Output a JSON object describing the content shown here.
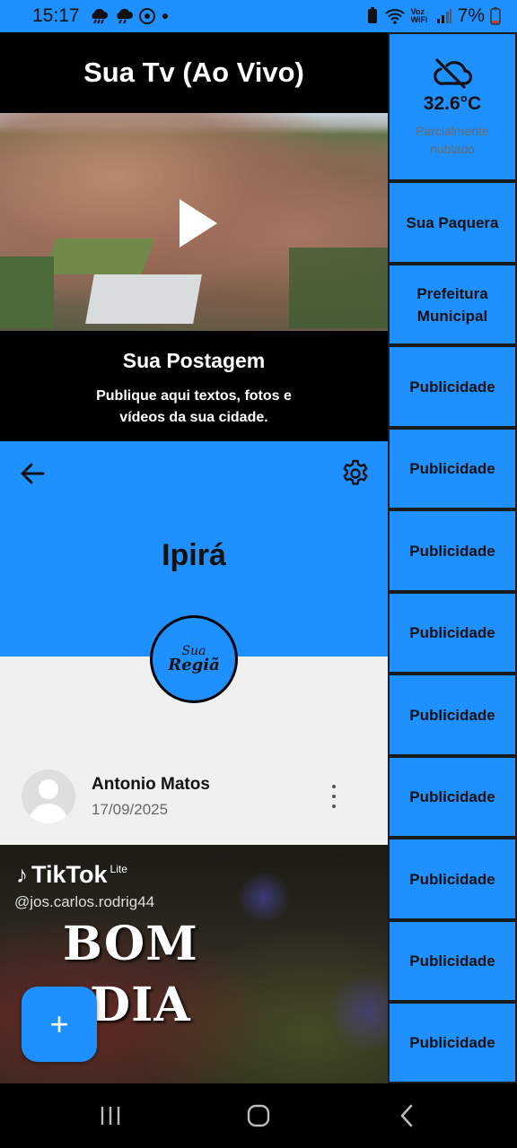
{
  "status_bar": {
    "time": "15:17",
    "network_label": "Voz WiFi",
    "battery": "7%"
  },
  "tv": {
    "title": "Sua Tv (Ao Vivo)"
  },
  "post_box": {
    "title": "Sua Postagem",
    "description": "Publique aqui textos, fotos e vídeos da sua cidade."
  },
  "city": {
    "name": "Ipirá",
    "logo_line1": "Sua",
    "logo_line2": "Regiã"
  },
  "post": {
    "author": "Antonio Matos",
    "date": "17/09/2025",
    "media": {
      "brand": "TikTok",
      "brand_suffix": "Lite",
      "username": "@jos.carlos.rodrig44",
      "line1": "BOM",
      "line2": "DIA"
    }
  },
  "fab": {
    "label": "+"
  },
  "sidebar": {
    "weather": {
      "temperature": "32.6°C",
      "condition": "Parcialmente nublado",
      "icon": "cloud-off-icon"
    },
    "items": [
      {
        "label": "Sua Paquera"
      },
      {
        "label": "Prefeitura Municipal"
      },
      {
        "label": "Publicidade"
      },
      {
        "label": "Publicidade"
      },
      {
        "label": "Publicidade"
      },
      {
        "label": "Publicidade"
      },
      {
        "label": "Publicidade"
      },
      {
        "label": "Publicidade"
      },
      {
        "label": "Publicidade"
      },
      {
        "label": "Publicidade"
      },
      {
        "label": "Publicidade"
      }
    ]
  },
  "colors": {
    "accent": "#1E90FF",
    "profile_bg": "#F0F0F0",
    "text_dark": "#111111"
  }
}
